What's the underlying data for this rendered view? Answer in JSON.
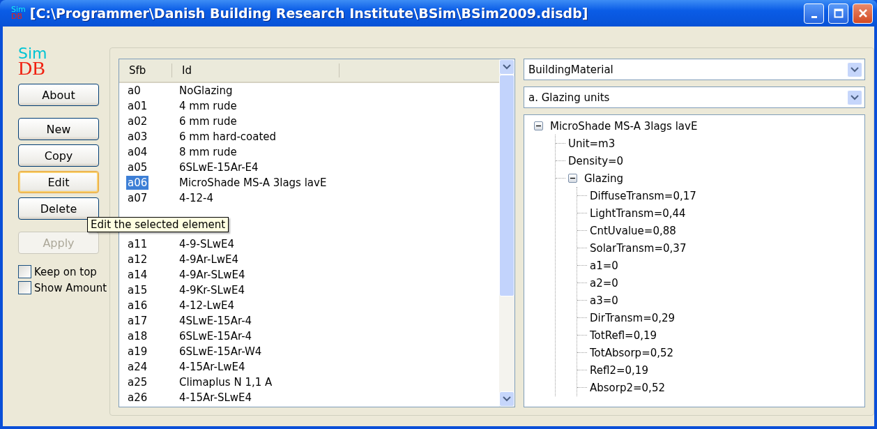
{
  "window": {
    "title": "[C:\\Programmer\\Danish Building Research Institute\\BSim\\BSim2009.disdb]",
    "icon_top": "Sim",
    "icon_bottom": "DB"
  },
  "logo": {
    "top": "Sim",
    "bottom": "DB"
  },
  "button_groups": [
    [
      {
        "label": "About",
        "focused": false,
        "disabled": false
      }
    ],
    [
      {
        "label": "New",
        "focused": false,
        "disabled": false
      },
      {
        "label": "Copy",
        "focused": false,
        "disabled": false
      },
      {
        "label": "Edit",
        "focused": true,
        "disabled": false
      },
      {
        "label": "Delete",
        "focused": false,
        "disabled": false
      }
    ],
    [
      {
        "label": "Apply",
        "focused": false,
        "disabled": true
      }
    ]
  ],
  "checkboxes": [
    {
      "label": "Keep on top",
      "checked": false
    },
    {
      "label": "Show Amount",
      "checked": false
    }
  ],
  "tooltip": "Edit the selected element",
  "table": {
    "columns": [
      "Sfb",
      "Id"
    ],
    "rows_above_tooltip": [
      {
        "sfb": "a0",
        "id": "NoGlazing",
        "selected": false
      },
      {
        "sfb": "a01",
        "id": "4 mm rude",
        "selected": false
      },
      {
        "sfb": "a02",
        "id": "6 mm rude",
        "selected": false
      },
      {
        "sfb": "a03",
        "id": "6 mm hard-coated",
        "selected": false
      },
      {
        "sfb": "a04",
        "id": "8 mm rude",
        "selected": false
      },
      {
        "sfb": "a05",
        "id": "6SLwE-15Ar-E4",
        "selected": false
      },
      {
        "sfb": "a06",
        "id": "MicroShade MS-A 3lags lavE",
        "selected": true
      },
      {
        "sfb": "a07",
        "id": "4-12-4",
        "selected": false
      }
    ],
    "rows_below_tooltip": [
      {
        "sfb": "a11",
        "id": "4-9-SLwE4",
        "selected": false
      },
      {
        "sfb": "a12",
        "id": "4-9Ar-LwE4",
        "selected": false
      },
      {
        "sfb": "a14",
        "id": "4-9Ar-SLwE4",
        "selected": false
      },
      {
        "sfb": "a15",
        "id": "4-9Kr-SLwE4",
        "selected": false
      },
      {
        "sfb": "a16",
        "id": "4-12-LwE4",
        "selected": false
      },
      {
        "sfb": "a17",
        "id": "4SLwE-15Ar-4",
        "selected": false
      },
      {
        "sfb": "a18",
        "id": "6SLwE-15Ar-4",
        "selected": false
      },
      {
        "sfb": "a19",
        "id": "6SLwE-15Ar-W4",
        "selected": false
      },
      {
        "sfb": "a24",
        "id": "4-15Ar-LwE4",
        "selected": false
      },
      {
        "sfb": "a25",
        "id": "Climaplus N 1,1 A",
        "selected": false
      },
      {
        "sfb": "a26",
        "id": "4-15Ar-SLwE4",
        "selected": false
      }
    ]
  },
  "dropdowns": [
    {
      "value": "BuildingMaterial"
    },
    {
      "value": "a. Glazing units"
    }
  ],
  "tree": [
    {
      "label": "MicroShade MS-A 3lags lavE",
      "expanded": true,
      "children": [
        {
          "label": "Unit=m3"
        },
        {
          "label": "Density=0"
        },
        {
          "label": "Glazing",
          "expanded": true,
          "children": [
            {
              "label": "DiffuseTransm=0,17"
            },
            {
              "label": "LightTransm=0,44"
            },
            {
              "label": "CntUvalue=0,88"
            },
            {
              "label": "SolarTransm=0,37"
            },
            {
              "label": "a1=0"
            },
            {
              "label": "a2=0"
            },
            {
              "label": "a3=0"
            },
            {
              "label": "DirTransm=0,29"
            },
            {
              "label": "TotRefl=0,19"
            },
            {
              "label": "TotAbsorp=0,52"
            },
            {
              "label": "Refl2=0,19"
            },
            {
              "label": "Absorp2=0,52"
            }
          ]
        }
      ]
    }
  ]
}
